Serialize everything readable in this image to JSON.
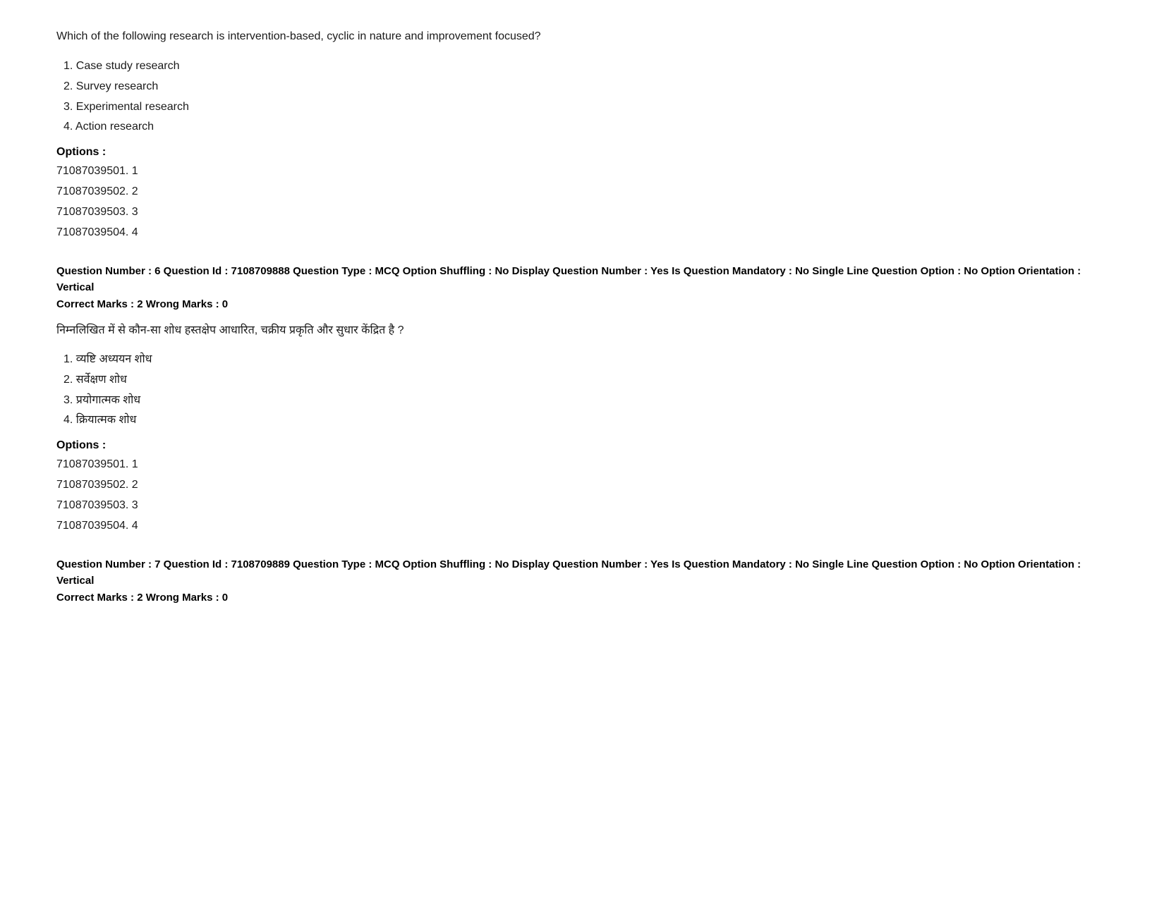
{
  "questions": [
    {
      "question_text": "Which of the following research is intervention-based, cyclic in nature and improvement focused?",
      "options_list": [
        "1. Case study research",
        "2. Survey research",
        "3. Experimental research",
        "4. Action research"
      ],
      "options_label": "Options :",
      "option_codes": [
        "71087039501. 1",
        "71087039502. 2",
        "71087039503. 3",
        "71087039504. 4"
      ]
    },
    {
      "meta_line1": "Question Number : 6 Question Id : 7108709888 Question Type : MCQ Option Shuffling : No Display Question Number : Yes Is Question Mandatory : No Single Line Question Option : No Option Orientation : Vertical",
      "meta_line2": "Correct Marks : 2 Wrong Marks : 0",
      "question_text_hindi": "निम्नलिखित में से कौन-सा शोध हस्तक्षेप आधारित, चक्रीय प्रकृति और सुधार केंद्रित है ?",
      "options_list": [
        "1. व्यष्टि अध्ययन शोध",
        "2. सर्वेक्षण शोध",
        "3. प्रयोगात्मक शोध",
        "4. क्रियात्मक शोध"
      ],
      "options_label": "Options :",
      "option_codes": [
        "71087039501. 1",
        "71087039502. 2",
        "71087039503. 3",
        "71087039504. 4"
      ]
    },
    {
      "meta_line1": "Question Number : 7 Question Id : 7108709889 Question Type : MCQ Option Shuffling : No Display Question Number : Yes Is Question Mandatory : No Single Line Question Option : No Option Orientation : Vertical",
      "meta_line2": "Correct Marks : 2 Wrong Marks : 0"
    }
  ]
}
